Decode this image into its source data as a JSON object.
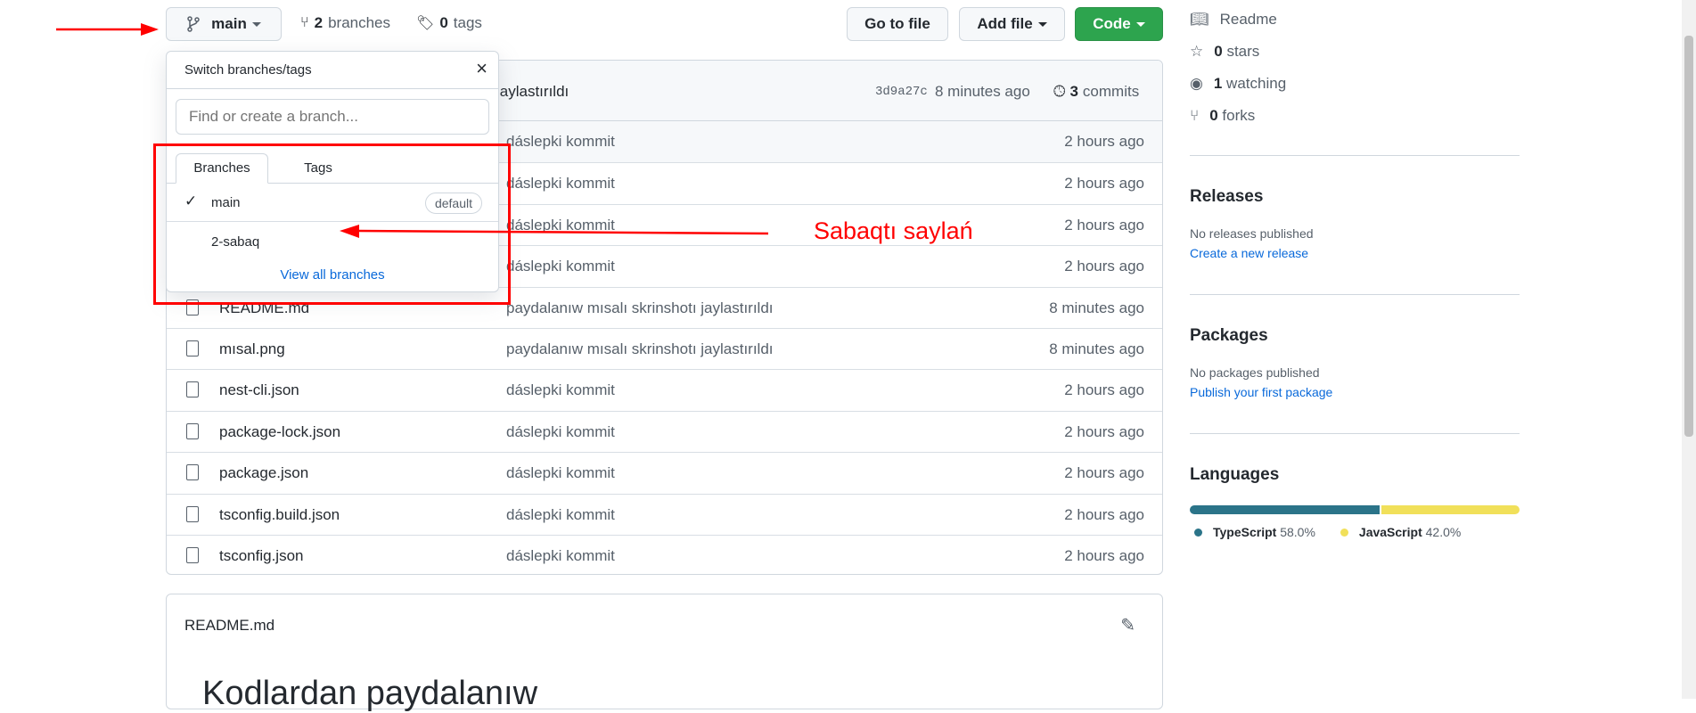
{
  "toolbar": {
    "branch": "main",
    "branches_count": "2",
    "branches_label": "branches",
    "tags_count": "0",
    "tags_label": "tags",
    "go_to_file": "Go to file",
    "add_file": "Add file",
    "code": "Code"
  },
  "commit": {
    "message_visible": "jaylastırıldı",
    "sha": "3d9a27c",
    "time": "8 minutes ago",
    "commits_count": "3",
    "commits_label": "commits"
  },
  "files": [
    {
      "name": "",
      "message": "dáslepki kommit",
      "time": "2 hours ago"
    },
    {
      "name": "",
      "message": "dáslepki kommit",
      "time": "2 hours ago"
    },
    {
      "name": "",
      "message": "dáslepki kommit",
      "time": "2 hours ago"
    },
    {
      "name": "",
      "message": "dáslepki kommit",
      "time": "2 hours ago"
    },
    {
      "name": "README.md",
      "message": "paydalanıw mısalı skrinshotı jaylastırıldı",
      "time": "8 minutes ago"
    },
    {
      "name": "mısal.png",
      "message": "paydalanıw mısalı skrinshotı jaylastırıldı",
      "time": "8 minutes ago"
    },
    {
      "name": "nest-cli.json",
      "message": "dáslepki kommit",
      "time": "2 hours ago"
    },
    {
      "name": "package-lock.json",
      "message": "dáslepki kommit",
      "time": "2 hours ago"
    },
    {
      "name": "package.json",
      "message": "dáslepki kommit",
      "time": "2 hours ago"
    },
    {
      "name": "tsconfig.build.json",
      "message": "dáslepki kommit",
      "time": "2 hours ago"
    },
    {
      "name": "tsconfig.json",
      "message": "dáslepki kommit",
      "time": "2 hours ago"
    }
  ],
  "dropdown": {
    "title": "Switch branches/tags",
    "placeholder": "Find or create a branch...",
    "tabs": [
      "Branches",
      "Tags"
    ],
    "branches": [
      {
        "name": "main",
        "badge": "default",
        "selected": true
      },
      {
        "name": "2-sabaq"
      }
    ],
    "view_all": "View all branches"
  },
  "annotation": {
    "label": "Sabaqtı saylań",
    "color": "#ff0000"
  },
  "readme": {
    "title": "README.md",
    "heading": "Kodlardan paydalanıw"
  },
  "sidebar": {
    "readme": "Readme",
    "stars_count": "0",
    "stars_label": "stars",
    "watching_count": "1",
    "watching_label": "watching",
    "forks_count": "0",
    "forks_label": "forks",
    "releases": {
      "title": "Releases",
      "empty": "No releases published",
      "link": "Create a new release"
    },
    "packages": {
      "title": "Packages",
      "empty": "No packages published",
      "link": "Publish your first package"
    },
    "languages": {
      "title": "Languages",
      "items": [
        {
          "name": "TypeScript",
          "percent": "58.0%",
          "value": 58.0,
          "color": "#2b7489"
        },
        {
          "name": "JavaScript",
          "percent": "42.0%",
          "value": 42.0,
          "color": "#f1e05a"
        }
      ]
    }
  },
  "colors": {
    "code_button": "#2da44e",
    "link": "#0969da"
  }
}
